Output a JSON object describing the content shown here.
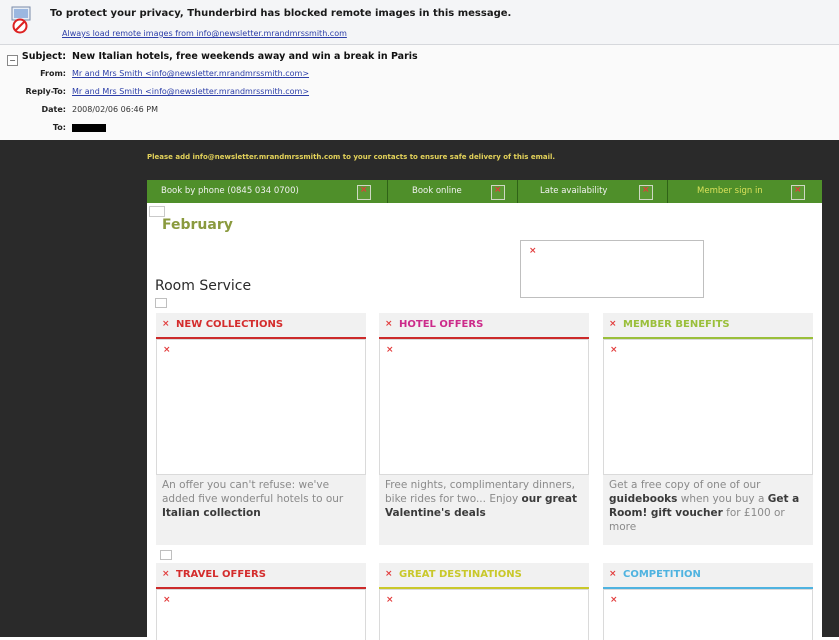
{
  "notification": {
    "message": "To protect your privacy, Thunderbird has blocked remote images in this message.",
    "load_link": "Always load remote images from info@newsletter.mrandmrssmith.com"
  },
  "headers": {
    "subject_label": "Subject:",
    "subject": "New Italian hotels, free weekends away and win a break in Paris",
    "from_label": "From:",
    "from": "Mr and Mrs Smith <info@newsletter.mrandmrssmith.com>",
    "reply_to_label": "Reply-To:",
    "reply_to": "Mr and Mrs Smith <info@newsletter.mrandmrssmith.com>",
    "date_label": "Date:",
    "date": "2008/02/06 06:46 PM",
    "to_label": "To:"
  },
  "email": {
    "add_contact_line": "Please add info@newsletter.mrandmrssmith.com to your contacts to ensure safe delivery of this email.",
    "nav": {
      "book_by_phone": "Book by phone (0845 034 0700)",
      "book_online": "Book online",
      "late_availability": "Late availability",
      "member_sign_in": "Member sign in"
    },
    "month": "February",
    "section_title": "Room Service",
    "cards_row1": [
      {
        "title": "NEW COLLECTIONS",
        "text_before": "An offer you can't refuse: we've added five wonderful hotels to our ",
        "text_bold": "Italian collection",
        "text_after": "",
        "color": "#d42c2c"
      },
      {
        "title": "HOTEL OFFERS",
        "text_before": "Free nights, complimentary dinners, bike rides for two... Enjoy ",
        "text_bold": "our great Valentine's deals",
        "text_after": "",
        "color": "#cc2a8a"
      },
      {
        "title": "MEMBER BENEFITS",
        "text_before": "Get a free copy of one of our ",
        "text_bold": "guidebooks",
        "text_after": " when you buy a ",
        "text_bold2": "Get a Room! gift voucher",
        "text_after2": " for £100 or more",
        "color": "#9abf3a"
      }
    ],
    "cards_row2": [
      {
        "title": "TRAVEL OFFERS",
        "color": "#d42c2c"
      },
      {
        "title": "GREAT DESTINATIONS",
        "color": "#c9c82a"
      },
      {
        "title": "COMPETITION",
        "color": "#4fb3e0"
      }
    ]
  },
  "colors": {
    "nav_green": "#4f8f2a",
    "accent_red": "#cc2a2a",
    "month_olive": "#8a9a3e",
    "link_blue": "#2c3ea8"
  },
  "icons": {
    "blocked_content": "shield-blocked-icon",
    "broken_image": "broken-image-icon"
  }
}
